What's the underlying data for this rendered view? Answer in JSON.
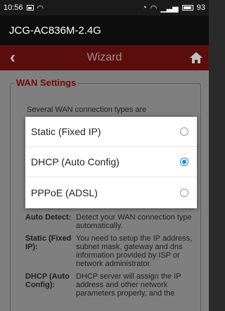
{
  "statusbar": {
    "time": "10:56",
    "battery": "93"
  },
  "app": {
    "title": "JCG-AC836M-2.4G"
  },
  "nav": {
    "title": "Wizard"
  },
  "wan": {
    "legend": "WAN Settings",
    "intro": "Several WAN connection types are",
    "descriptions": [
      {
        "term": "Auto Detect:",
        "text": "Detect your WAN connection type automatically."
      },
      {
        "term": "Static (Fixed IP):",
        "text": "You need to setup the IP address, subnet mask, gateway and dns information provided by ISP or network administrator."
      },
      {
        "term": "DHCP (Auto Config):",
        "text": "DHCP server will assign the IP address and other network parameters properly, and the"
      }
    ]
  },
  "dialog": {
    "options": [
      {
        "label": "Static (Fixed IP)",
        "selected": false
      },
      {
        "label": "DHCP (Auto Config)",
        "selected": true
      },
      {
        "label": "PPPoE (ADSL)",
        "selected": false
      }
    ]
  },
  "colors": {
    "nav_bg": "#5a0e0e",
    "legend": "#6e0c0c",
    "radio_selected": "#1e88e5"
  }
}
